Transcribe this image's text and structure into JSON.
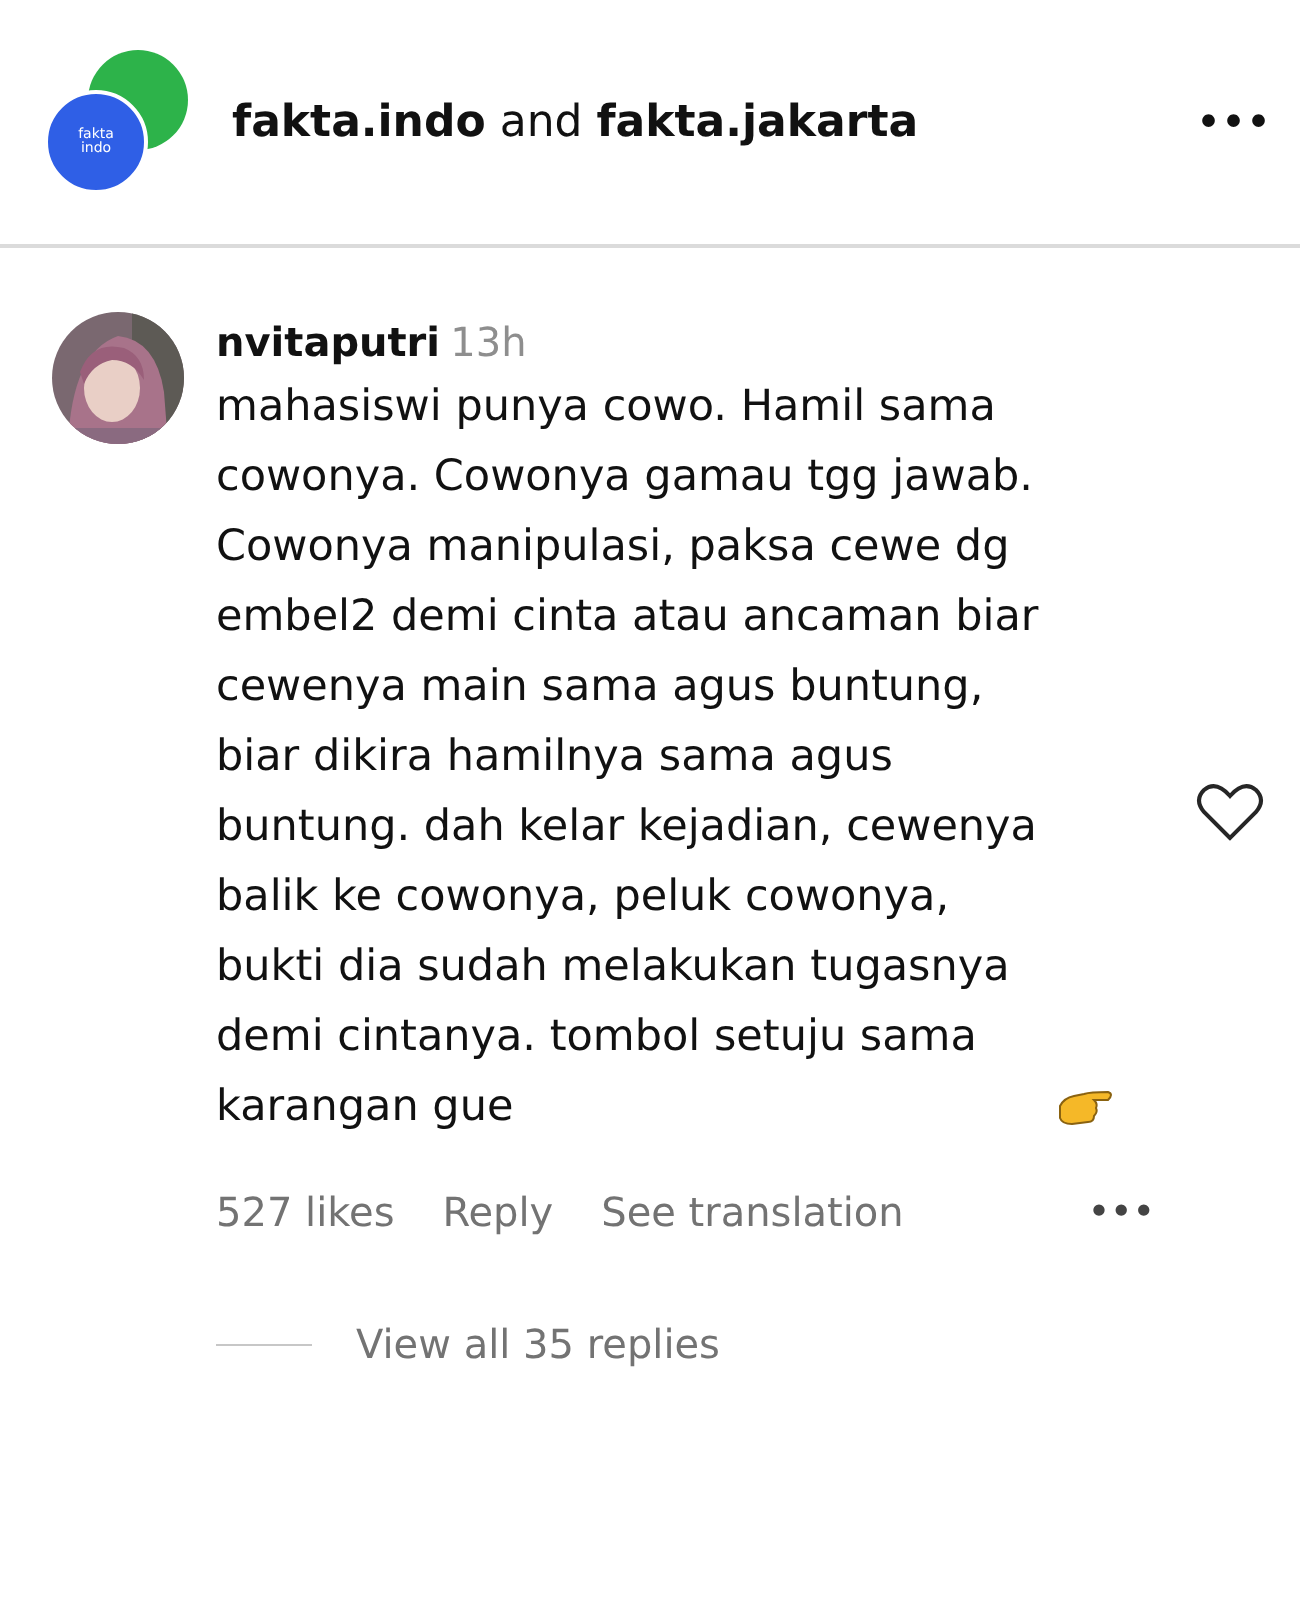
{
  "header": {
    "logo_text": "fakta indo",
    "title": "**fakta.indo** and **fakta.jakarta**",
    "more": "•••"
  },
  "comment": {
    "username": "nvitaputri",
    "time": "13h",
    "text": "mahasiswi punya cowo. Hamil sama cowonya. Cowonya gamau tgg jawab. Cowonya manipulasi, paksa cewe dg embel2 demi cinta atau ancaman biar cewenya main sama agus buntung, biar dikira hamilnya sama agus buntung. dah kelar kejadian, cewenya balik ke cowonya, peluk cowonya, bukti dia sudah melakukan tugasnya demi cintanya. tombol setuju sama karangan gue",
    "liked": false,
    "likes": "527 likes",
    "reply": "Reply",
    "translation": "See translation",
    "more": "•••",
    "view_replies": "View all 35 replies"
  }
}
